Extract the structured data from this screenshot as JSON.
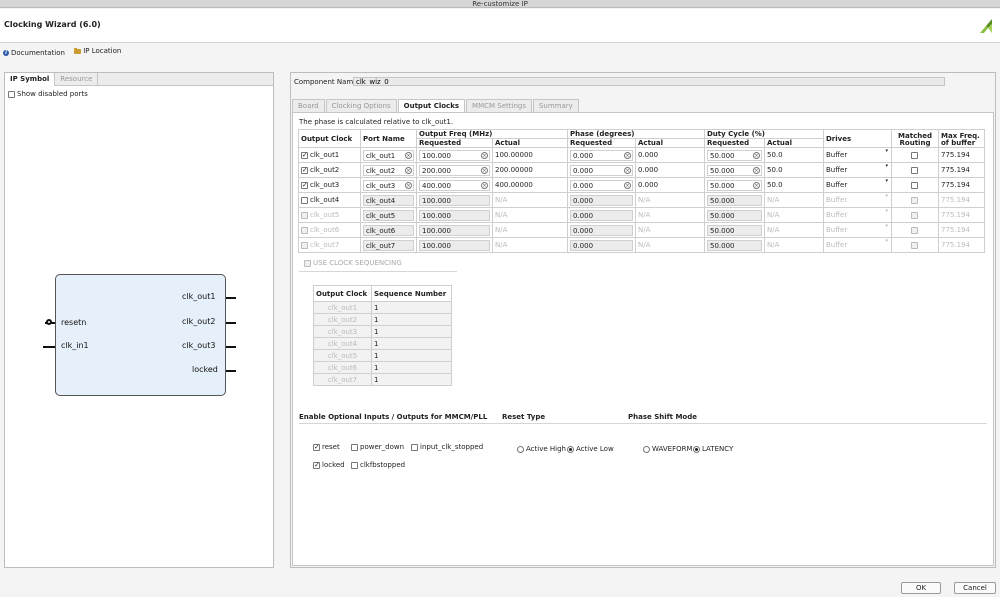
{
  "window_title": "Re-customize IP",
  "wizard_title": "Clocking Wizard (6.0)",
  "links": {
    "documentation": "Documentation",
    "ip_location": "IP Location"
  },
  "left": {
    "tabs": [
      "IP Symbol",
      "Resource"
    ],
    "show_disabled_ports": "Show disabled ports",
    "symbol": {
      "inputs": [
        "resetn",
        "clk_in1"
      ],
      "outputs": [
        "clk_out1",
        "clk_out2",
        "clk_out3",
        "locked"
      ]
    }
  },
  "component_name_label": "Component Name",
  "component_name_value": "clk_wiz_0",
  "right_tabs": [
    "Board",
    "Clocking Options",
    "Output Clocks",
    "MMCM Settings",
    "Summary"
  ],
  "phase_note": "The phase is calculated relative to clk_out1.",
  "table": {
    "headers": {
      "output_clock": "Output Clock",
      "port_name": "Port Name",
      "output_freq": "Output Freq (MHz)",
      "phase": "Phase (degrees)",
      "duty": "Duty Cycle (%)",
      "drives": "Drives",
      "matched_1": "Matched",
      "matched_2": "Routing",
      "maxfreq_1": "Max Freq.",
      "maxfreq_2": "of buffer",
      "requested": "Requested",
      "actual": "Actual"
    },
    "rows": [
      {
        "name": "clk_out1",
        "checked": true,
        "enabled": true,
        "port": "clk_out1",
        "freq_req": "100.000",
        "freq_act": "100.00000",
        "phase_req": "0.000",
        "phase_act": "0.000",
        "duty_req": "50.000",
        "duty_act": "50.0",
        "drives": "Buffer",
        "maxfreq": "775.194"
      },
      {
        "name": "clk_out2",
        "checked": true,
        "enabled": true,
        "port": "clk_out2",
        "freq_req": "200.000",
        "freq_act": "200.00000",
        "phase_req": "0.000",
        "phase_act": "0.000",
        "duty_req": "50.000",
        "duty_act": "50.0",
        "drives": "Buffer",
        "maxfreq": "775.194"
      },
      {
        "name": "clk_out3",
        "checked": true,
        "enabled": true,
        "port": "clk_out3",
        "freq_req": "400.000",
        "freq_act": "400.00000",
        "phase_req": "0.000",
        "phase_act": "0.000",
        "duty_req": "50.000",
        "duty_act": "50.0",
        "drives": "Buffer",
        "maxfreq": "775.194"
      },
      {
        "name": "clk_out4",
        "checked": false,
        "enabled": true,
        "port": "clk_out4",
        "freq_req": "100.000",
        "freq_act": "N/A",
        "phase_req": "0.000",
        "phase_act": "N/A",
        "duty_req": "50.000",
        "duty_act": "N/A",
        "drives": "Buffer",
        "maxfreq": "775.194"
      },
      {
        "name": "clk_out5",
        "checked": false,
        "enabled": false,
        "port": "clk_out5",
        "freq_req": "100.000",
        "freq_act": "N/A",
        "phase_req": "0.000",
        "phase_act": "N/A",
        "duty_req": "50.000",
        "duty_act": "N/A",
        "drives": "Buffer",
        "maxfreq": "775.194"
      },
      {
        "name": "clk_out6",
        "checked": false,
        "enabled": false,
        "port": "clk_out6",
        "freq_req": "100.000",
        "freq_act": "N/A",
        "phase_req": "0.000",
        "phase_act": "N/A",
        "duty_req": "50.000",
        "duty_act": "N/A",
        "drives": "Buffer",
        "maxfreq": "775.194"
      },
      {
        "name": "clk_out7",
        "checked": false,
        "enabled": false,
        "port": "clk_out7",
        "freq_req": "100.000",
        "freq_act": "N/A",
        "phase_req": "0.000",
        "phase_act": "N/A",
        "duty_req": "50.000",
        "duty_act": "N/A",
        "drives": "Buffer",
        "maxfreq": "775.194"
      }
    ]
  },
  "sequencing": {
    "label": "USE CLOCK SEQUENCING",
    "headers": [
      "Output Clock",
      "Sequence Number"
    ],
    "rows": [
      {
        "clock": "clk_out1",
        "seq": "1"
      },
      {
        "clock": "clk_out2",
        "seq": "1"
      },
      {
        "clock": "clk_out3",
        "seq": "1"
      },
      {
        "clock": "clk_out4",
        "seq": "1"
      },
      {
        "clock": "clk_out5",
        "seq": "1"
      },
      {
        "clock": "clk_out6",
        "seq": "1"
      },
      {
        "clock": "clk_out7",
        "seq": "1"
      }
    ]
  },
  "optional": {
    "title": "Enable Optional Inputs / Outputs for MMCM/PLL",
    "reset": "reset",
    "power_down": "power_down",
    "input_clk_stopped": "input_clk_stopped",
    "locked": "locked",
    "clkfbstopped": "clkfbstopped"
  },
  "reset_type": {
    "title": "Reset Type",
    "high": "Active High",
    "low": "Active Low"
  },
  "phase_shift": {
    "title": "Phase Shift Mode",
    "waveform": "WAVEFORM",
    "latency": "LATENCY"
  },
  "buttons": {
    "ok": "OK",
    "cancel": "Cancel"
  }
}
